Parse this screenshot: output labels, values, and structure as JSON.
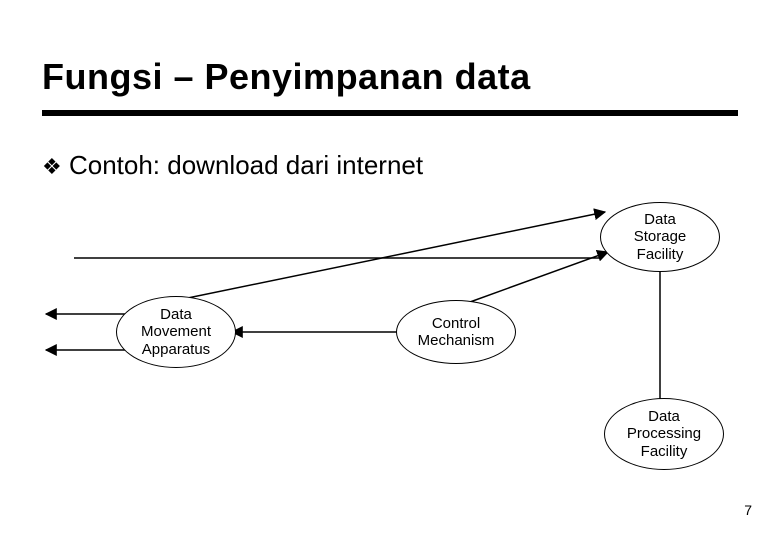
{
  "title": "Fungsi – Penyimpanan data",
  "bullet_icon": "❖",
  "bullet_text": "Contoh: download dari internet",
  "nodes": {
    "storage": "Data\nStorage\nFacility",
    "movement": "Data\nMovement\nApparatus",
    "control": "Control\nMechanism",
    "processing": "Data\nProcessing\nFacility"
  },
  "page_number": "7"
}
